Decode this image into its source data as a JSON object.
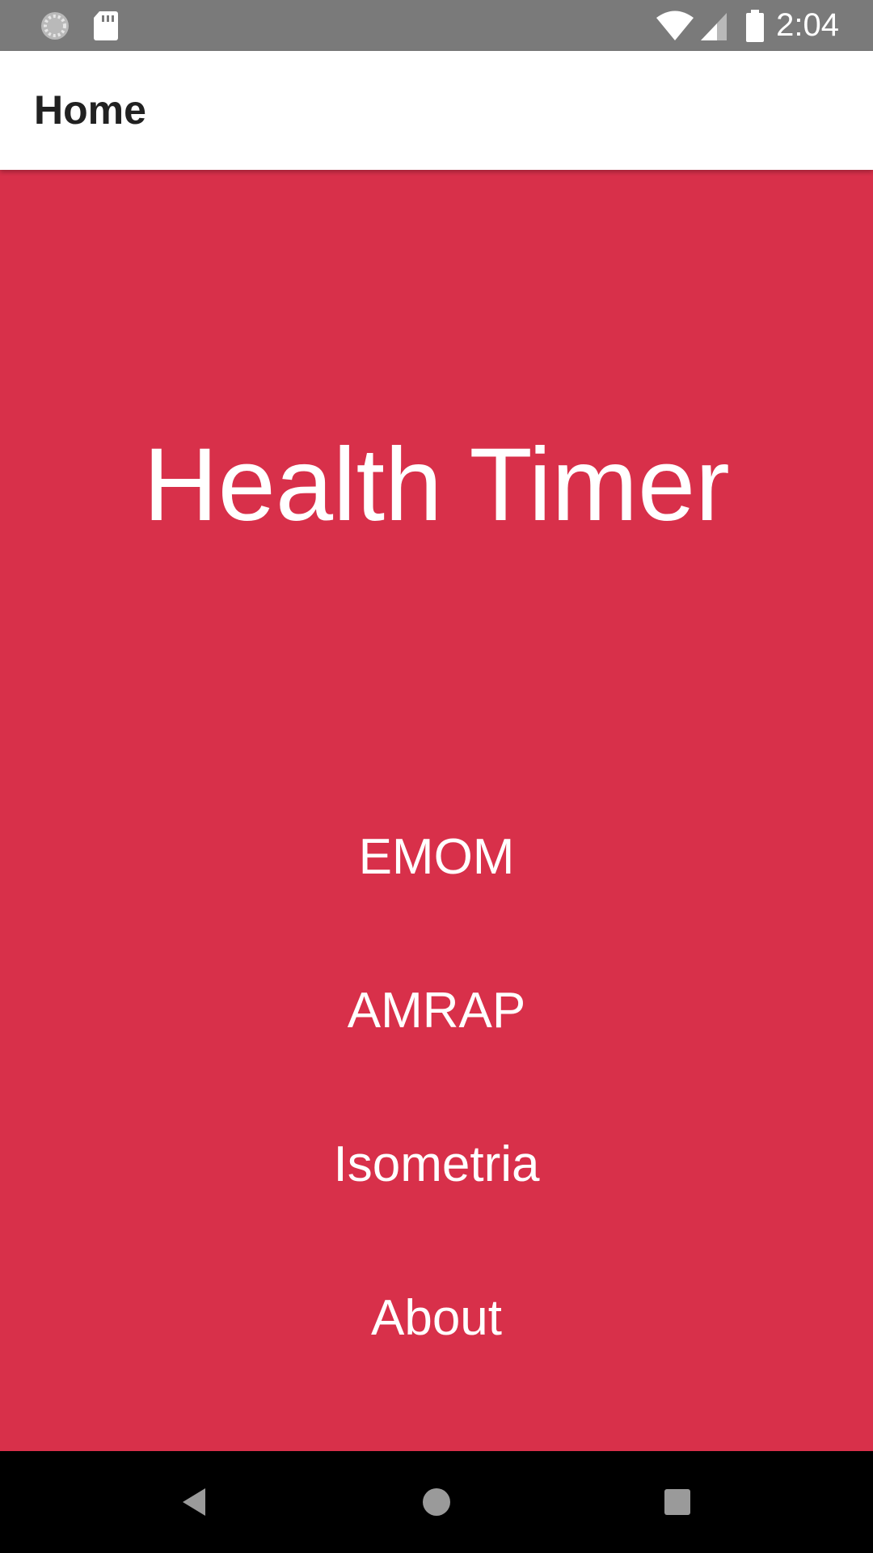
{
  "status_bar": {
    "time": "2:04",
    "icons": [
      "sync-icon",
      "sd-card-icon",
      "wifi-icon",
      "signal-icon",
      "battery-icon"
    ]
  },
  "app_bar": {
    "title": "Home"
  },
  "main": {
    "app_title": "Health Timer",
    "menu": [
      {
        "label": "EMOM"
      },
      {
        "label": "AMRAP"
      },
      {
        "label": "Isometria"
      },
      {
        "label": "About"
      }
    ]
  },
  "nav_bar": {
    "icons": [
      "back-icon",
      "home-icon",
      "recents-icon"
    ]
  },
  "colors": {
    "accent": "#d8304a",
    "status_bar": "#7a7a7a",
    "app_bar": "#ffffff",
    "nav_bar": "#000000"
  }
}
